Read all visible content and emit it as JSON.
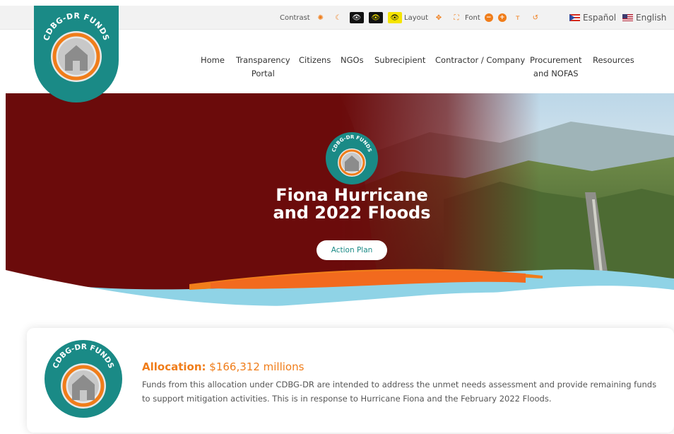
{
  "a11y": {
    "contrast_label": "Contrast",
    "layout_label": "Layout",
    "font_label": "Font"
  },
  "languages": [
    {
      "label": "Español",
      "flag": "puerto-rico-flag-icon"
    },
    {
      "label": "English",
      "flag": "us-flag-icon"
    }
  ],
  "logo": {
    "text": "CDBG-DR FUNDS"
  },
  "nav": [
    {
      "label": "Home"
    },
    {
      "label": "Transparency",
      "label2": "Portal"
    },
    {
      "label": "Citizens"
    },
    {
      "label": "NGOs"
    },
    {
      "label": "Subrecipient"
    },
    {
      "label": "Contractor / Company"
    },
    {
      "label": "Procurement",
      "label2": "and NOFAS"
    },
    {
      "label": "Resources"
    }
  ],
  "hero": {
    "title_line1": "Fiona Hurricane",
    "title_line2": "and 2022 Floods",
    "button_label": "Action Plan"
  },
  "allocation": {
    "label": "Allocation:",
    "amount": "$166,312 millions",
    "description": "Funds from this allocation under CDBG-DR are intended to address the unmet needs assessment and provide remaining funds to support mitigation activities. This is in response to Hurricane Fiona and the February 2022 Floods."
  },
  "colors": {
    "teal": "#1a8a86",
    "orange": "#f07d1a",
    "maroon": "#6b0b0b",
    "light_blue": "#8fd3e6"
  }
}
